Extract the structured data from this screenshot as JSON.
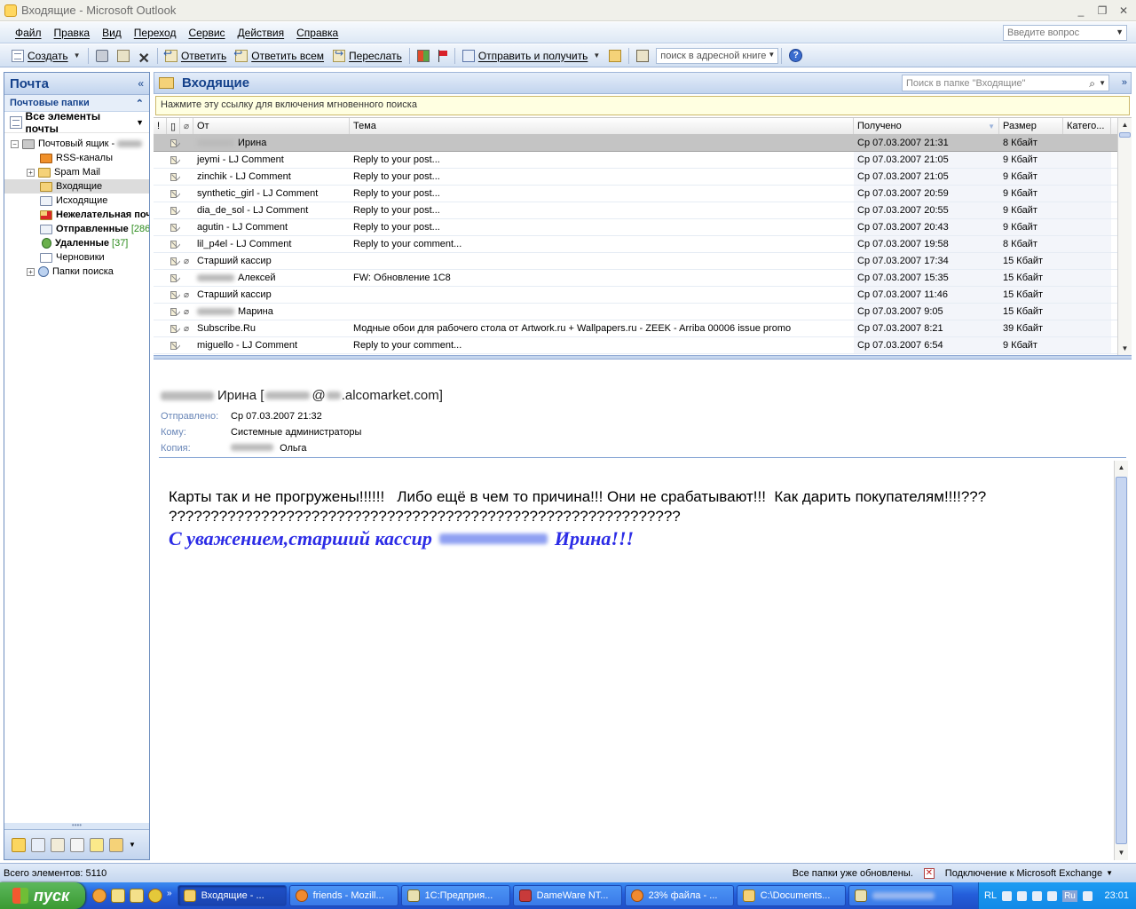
{
  "window": {
    "title": "Входящие - Microsoft Outlook",
    "min": "_",
    "max": "❐",
    "close": "✕"
  },
  "menu": {
    "items": [
      "Файл",
      "Правка",
      "Вид",
      "Переход",
      "Сервис",
      "Действия",
      "Справка"
    ],
    "help_placeholder": "Введите вопрос"
  },
  "toolbar": {
    "new_label": "Создать",
    "reply_label": "Ответить",
    "reply_all_label": "Ответить всем",
    "forward_label": "Переслать",
    "send_receive_label": "Отправить и получить",
    "address_search_placeholder": "поиск в адресной книге"
  },
  "nav": {
    "title": "Почта",
    "section": "Почтовые папки",
    "all_mail": "Все элементы почты",
    "mailbox": "Почтовый ящик -",
    "folders": [
      {
        "label": "RSS-каналы",
        "bold": false,
        "count": ""
      },
      {
        "label": "Spam Mail",
        "bold": false,
        "count": ""
      },
      {
        "label": "Входящие",
        "bold": false,
        "count": ""
      },
      {
        "label": "Исходящие",
        "bold": false,
        "count": ""
      },
      {
        "label": "Нежелательная поч",
        "bold": true,
        "count": ""
      },
      {
        "label": "Отправленные",
        "bold": true,
        "count": "[286"
      },
      {
        "label": "Удаленные",
        "bold": true,
        "count": "[37]"
      },
      {
        "label": "Черновики",
        "bold": false,
        "count": ""
      },
      {
        "label": "Папки поиска",
        "bold": false,
        "count": ""
      }
    ]
  },
  "inbox": {
    "title": "Входящие",
    "search_placeholder": "Поиск в папке \"Входящие\"",
    "instant_search_bar": "Нажмите эту ссылку для включения мгновенного поиска"
  },
  "columns": {
    "from": "От",
    "subject": "Тема",
    "received": "Получено",
    "size": "Размер",
    "category": "Катего..."
  },
  "messages": [
    {
      "from": "Ирина",
      "blur": true,
      "clip": false,
      "subject": "",
      "received": "Ср 07.03.2007 21:31",
      "size": "8 Кбайт",
      "selected": true
    },
    {
      "from": "jeymi - LJ Comment",
      "blur": false,
      "clip": false,
      "subject": "Reply to your post...",
      "received": "Ср 07.03.2007 21:05",
      "size": "9 Кбайт"
    },
    {
      "from": "zinchik - LJ Comment",
      "blur": false,
      "clip": false,
      "subject": "Reply to your post...",
      "received": "Ср 07.03.2007 21:05",
      "size": "9 Кбайт"
    },
    {
      "from": "synthetic_girl - LJ Comment",
      "blur": false,
      "clip": false,
      "subject": "Reply to your post...",
      "received": "Ср 07.03.2007 20:59",
      "size": "9 Кбайт"
    },
    {
      "from": "dia_de_sol - LJ Comment",
      "blur": false,
      "clip": false,
      "subject": "Reply to your post...",
      "received": "Ср 07.03.2007 20:55",
      "size": "9 Кбайт"
    },
    {
      "from": "agutin - LJ Comment",
      "blur": false,
      "clip": false,
      "subject": "Reply to your post...",
      "received": "Ср 07.03.2007 20:43",
      "size": "9 Кбайт"
    },
    {
      "from": "lil_p4el - LJ Comment",
      "blur": false,
      "clip": false,
      "subject": "Reply to your comment...",
      "received": "Ср 07.03.2007 19:58",
      "size": "8 Кбайт"
    },
    {
      "from": "Старший кассир",
      "blur": false,
      "clip": true,
      "subject": "",
      "received": "Ср 07.03.2007 17:34",
      "size": "15 Кбайт"
    },
    {
      "from": "Алексей",
      "blur": true,
      "clip": false,
      "subject": "FW: Обновление 1C8",
      "received": "Ср 07.03.2007 15:35",
      "size": "15 Кбайт"
    },
    {
      "from": "Старший кассир",
      "blur": false,
      "clip": true,
      "subject": "",
      "received": "Ср 07.03.2007 11:46",
      "size": "15 Кбайт"
    },
    {
      "from": "Марина",
      "blur": true,
      "clip": true,
      "subject": "",
      "received": "Ср 07.03.2007 9:05",
      "size": "15 Кбайт"
    },
    {
      "from": "Subscribe.Ru",
      "blur": false,
      "clip": true,
      "subject": "Модные обои для рабочего стола от Artwork.ru + Wallpapers.ru - ZEEK - Arriba 00006 issue promo",
      "received": "Ср 07.03.2007 8:21",
      "size": "39 Кбайт"
    },
    {
      "from": "miguello - LJ Comment",
      "blur": false,
      "clip": false,
      "subject": "Reply to your comment...",
      "received": "Ср 07.03.2007 6:54",
      "size": "9 Кбайт"
    }
  ],
  "reading": {
    "from_name": "Ирина [",
    "from_email_tail": ".alcomarket.com]",
    "sent_label": "Отправлено:",
    "sent_value": "Ср 07.03.2007 21:32",
    "to_label": "Кому:",
    "to_value": "Системные администраторы",
    "cc_label": "Копия:",
    "cc_value": "Ольга",
    "body_line1": "Карты так и не прогружены!!!!!!   Либо ещё в чем то причина!!! Они не срабатывают!!!  Как дарить покупателям!!!!???",
    "body_line2": "?????????????????????????????????????????????????????????????",
    "signature_start": "С уважением,старший кассир",
    "signature_end": "Ирина!!!"
  },
  "status": {
    "count": "Всего элементов: 5110",
    "updated": "Все папки уже обновлены.",
    "connection": "Подключение к Microsoft Exchange"
  },
  "taskbar": {
    "start": "пуск",
    "tasks": [
      "Входящие - ...",
      "friends - Mozill...",
      "1С:Предприя...",
      "DameWare NT...",
      "23% файла - ...",
      "C:\\Documents..."
    ],
    "lang": "RL",
    "lang2": "Ru",
    "clock": "23:01"
  }
}
